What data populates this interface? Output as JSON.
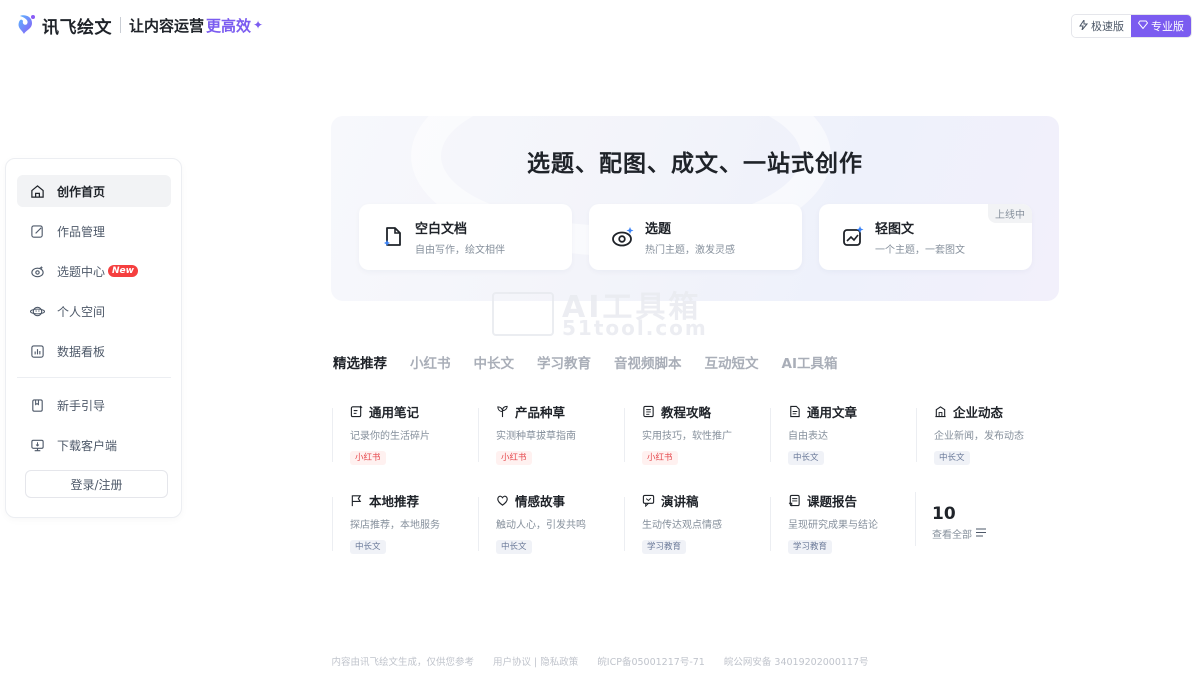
{
  "header": {
    "logo_text": "讯飞绘文",
    "slogan": "让内容运营",
    "slogan_accent": "更高效",
    "sparkle": "✦",
    "versions": [
      {
        "label": "极速版",
        "icon": "lightning-icon",
        "active": false
      },
      {
        "label": "专业版",
        "icon": "diamond-icon",
        "active": true
      }
    ]
  },
  "sidebar": {
    "items": [
      {
        "label": "创作首页",
        "icon": "home-icon",
        "active": true
      },
      {
        "label": "作品管理",
        "icon": "edit-icon"
      },
      {
        "label": "选题中心",
        "icon": "eye-icon",
        "badge": "New"
      },
      {
        "label": "个人空间",
        "icon": "planet-icon"
      },
      {
        "label": "数据看板",
        "icon": "chart-icon"
      },
      {
        "label": "新手引导",
        "icon": "book-icon"
      },
      {
        "label": "下载客户端",
        "icon": "monitor-icon"
      }
    ],
    "login_label": "登录/注册"
  },
  "hero": {
    "title": "选题、配图、成文、一站式创作",
    "cards": [
      {
        "title": "空白文档",
        "desc": "自由写作，绘文相伴",
        "icon": "doc-sparkle-icon"
      },
      {
        "title": "选题",
        "desc": "热门主题，激发灵感",
        "icon": "eye-sparkle-icon"
      },
      {
        "title": "轻图文",
        "desc": "一个主题，一套图文",
        "icon": "image-sparkle-icon",
        "tag": "上线中"
      }
    ]
  },
  "watermark": {
    "line1": "AI工具箱",
    "line2": "51tool.com"
  },
  "tabs": [
    "精选推荐",
    "小红书",
    "中长文",
    "学习教育",
    "音视频脚本",
    "互动短文",
    "AI工具箱"
  ],
  "templates": [
    {
      "title": "通用笔记",
      "desc": "记录你的生活碎片",
      "tag": "小红书",
      "icon": "note-icon"
    },
    {
      "title": "产品种草",
      "desc": "实测种草拔草指南",
      "tag": "小红书",
      "icon": "sprout-icon"
    },
    {
      "title": "教程攻略",
      "desc": "实用技巧，软性推广",
      "tag": "小红书",
      "icon": "list-icon"
    },
    {
      "title": "通用文章",
      "desc": "自由表达",
      "tag": "中长文",
      "icon": "article-icon"
    },
    {
      "title": "企业动态",
      "desc": "企业新闻，发布动态",
      "tag": "中长文",
      "icon": "building-icon"
    },
    {
      "title": "本地推荐",
      "desc": "探店推荐，本地服务",
      "tag": "中长文",
      "icon": "flag-icon"
    },
    {
      "title": "情感故事",
      "desc": "触动人心，引发共鸣",
      "tag": "中长文",
      "icon": "heart-icon"
    },
    {
      "title": "演讲稿",
      "desc": "生动传达观点情感",
      "tag": "学习教育",
      "icon": "speech-icon"
    },
    {
      "title": "课题报告",
      "desc": "呈现研究成果与结论",
      "tag": "学习教育",
      "icon": "report-icon"
    }
  ],
  "more": {
    "count": "10",
    "label": "查看全部"
  },
  "footer": [
    "内容由讯飞绘文生成，仅供您参考",
    "用户协议 | 隐私政策",
    "皖ICP备05001217号-71",
    "皖公网安备 34019202000117号"
  ]
}
